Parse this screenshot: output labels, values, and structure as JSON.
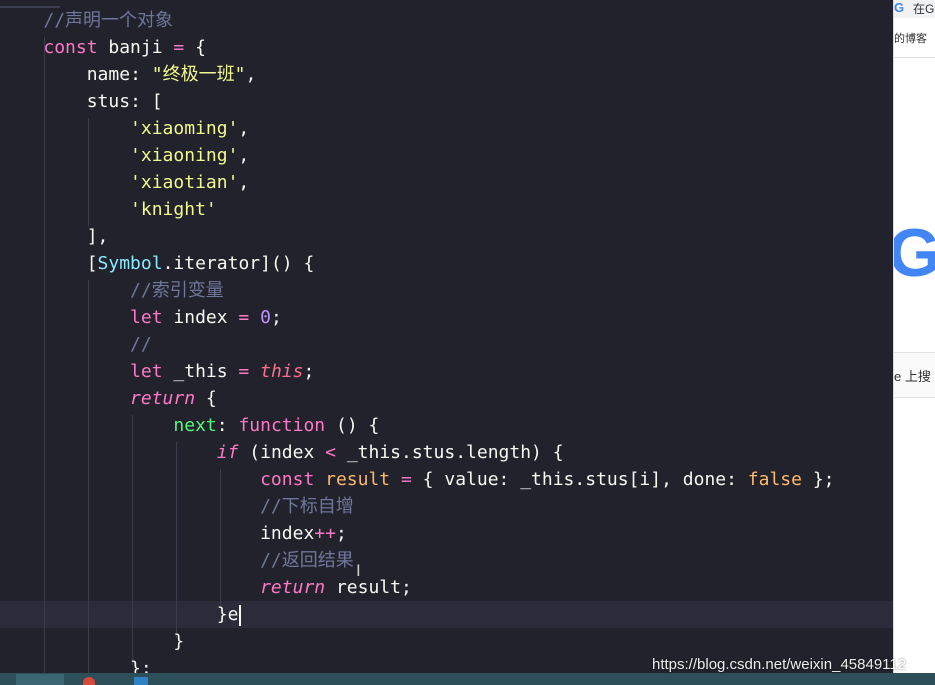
{
  "editor": {
    "lines": [
      [
        {
          "t": "    "
        },
        {
          "t": "//声明一个对象",
          "c": "com"
        }
      ],
      [
        {
          "t": "    "
        },
        {
          "t": "const",
          "c": "kw"
        },
        {
          "t": " banji "
        },
        {
          "t": "=",
          "c": "op"
        },
        {
          "t": " {"
        }
      ],
      [
        {
          "t": "        "
        },
        {
          "t": "name",
          "c": "prop"
        },
        {
          "t": ": "
        },
        {
          "t": "\"终极一班\"",
          "c": "str"
        },
        {
          "t": ","
        }
      ],
      [
        {
          "t": "        "
        },
        {
          "t": "stus",
          "c": "prop"
        },
        {
          "t": ": ["
        }
      ],
      [
        {
          "t": "            "
        },
        {
          "t": "'xiaoming'",
          "c": "str"
        },
        {
          "t": ","
        }
      ],
      [
        {
          "t": "            "
        },
        {
          "t": "'xiaoning'",
          "c": "str"
        },
        {
          "t": ","
        }
      ],
      [
        {
          "t": "            "
        },
        {
          "t": "'xiaotian'",
          "c": "str"
        },
        {
          "t": ","
        }
      ],
      [
        {
          "t": "            "
        },
        {
          "t": "'knight'",
          "c": "str"
        }
      ],
      [
        {
          "t": "        "
        },
        {
          "t": "],"
        }
      ],
      [
        {
          "t": "        "
        },
        {
          "t": "["
        },
        {
          "t": "Symbol",
          "c": "cls"
        },
        {
          "t": "."
        },
        {
          "t": "iterator",
          "c": "prop"
        },
        {
          "t": "]"
        },
        {
          "t": "() {"
        }
      ],
      [
        {
          "t": "            "
        },
        {
          "t": "//索引变量",
          "c": "com"
        }
      ],
      [
        {
          "t": "            "
        },
        {
          "t": "let",
          "c": "kw"
        },
        {
          "t": " index "
        },
        {
          "t": "=",
          "c": "op"
        },
        {
          "t": " "
        },
        {
          "t": "0",
          "c": "num"
        },
        {
          "t": ";"
        }
      ],
      [
        {
          "t": "            "
        },
        {
          "t": "//",
          "c": "com"
        }
      ],
      [
        {
          "t": "            "
        },
        {
          "t": "let",
          "c": "kw"
        },
        {
          "t": " _this "
        },
        {
          "t": "=",
          "c": "op"
        },
        {
          "t": " "
        },
        {
          "t": "this",
          "c": "this"
        },
        {
          "t": ";"
        }
      ],
      [
        {
          "t": "            "
        },
        {
          "t": "return",
          "c": "kwi"
        },
        {
          "t": " {"
        }
      ],
      [
        {
          "t": "                "
        },
        {
          "t": "next",
          "c": "fn"
        },
        {
          "t": ": "
        },
        {
          "t": "function",
          "c": "kw"
        },
        {
          "t": " () {"
        }
      ],
      [
        {
          "t": "                    "
        },
        {
          "t": "if",
          "c": "kwi"
        },
        {
          "t": " (index "
        },
        {
          "t": "<",
          "c": "op"
        },
        {
          "t": " _this.stus.length) {"
        }
      ],
      [
        {
          "t": "                        "
        },
        {
          "t": "const",
          "c": "kw"
        },
        {
          "t": " "
        },
        {
          "t": "result",
          "c": "res"
        },
        {
          "t": " "
        },
        {
          "t": "=",
          "c": "op"
        },
        {
          "t": " { value: _this.stus[i], done: "
        },
        {
          "t": "false",
          "c": "bool"
        },
        {
          "t": " };"
        }
      ],
      [
        {
          "t": "                        "
        },
        {
          "t": "//下标自增",
          "c": "com"
        }
      ],
      [
        {
          "t": "                        "
        },
        {
          "t": "index"
        },
        {
          "t": "++",
          "c": "op"
        },
        {
          "t": ";"
        }
      ],
      [
        {
          "t": "                        "
        },
        {
          "t": "//返回结果",
          "c": "com"
        }
      ],
      [
        {
          "t": "                        "
        },
        {
          "t": "return",
          "c": "kwi"
        },
        {
          "t": " result;"
        }
      ],
      [
        {
          "t": "                    "
        },
        {
          "t": "}e"
        }
      ],
      [
        {
          "t": "                "
        },
        {
          "t": "}"
        }
      ],
      [
        {
          "t": "            "
        },
        {
          "t": "};"
        }
      ]
    ],
    "current_line_index": 22
  },
  "browser": {
    "top_label": "在G",
    "bookmark_text": "的博客",
    "search_text": "e 上搜"
  },
  "watermark": "https://blog.csdn.net/weixin_45849112",
  "colors": {
    "editor_bg": "#21222c",
    "comment": "#6f779a",
    "keyword": "#ff79c6",
    "string": "#f1fa8c",
    "number": "#bd93f9",
    "boolean": "#ffb86c",
    "class": "#8be9fd",
    "function": "#50fa7b"
  }
}
